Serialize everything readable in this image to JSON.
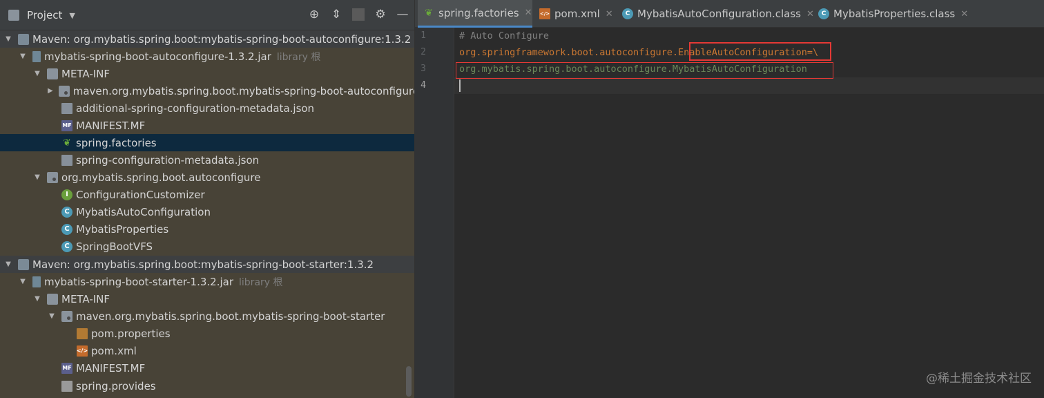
{
  "project_panel": {
    "title": "Project",
    "tree": [
      {
        "label": "Maven: org.mybatis.spring.boot:mybatis-spring-boot-autoconfigure:1.3.2",
        "icon": "maven-library-icon"
      },
      {
        "label": "mybatis-spring-boot-autoconfigure-1.3.2.jar",
        "note": "library 根",
        "icon": "jar-icon"
      },
      {
        "label": "META-INF",
        "icon": "folder-icon"
      },
      {
        "label": "maven.org.mybatis.spring.boot.mybatis-spring-boot-autoconfigure",
        "icon": "package-folder-icon"
      },
      {
        "label": "additional-spring-configuration-metadata.json",
        "icon": "json-spring-icon"
      },
      {
        "label": "MANIFEST.MF",
        "icon": "manifest-icon"
      },
      {
        "label": "spring.factories",
        "icon": "spring-leaf-icon"
      },
      {
        "label": "spring-configuration-metadata.json",
        "icon": "json-file-icon"
      },
      {
        "label": "org.mybatis.spring.boot.autoconfigure",
        "icon": "package-folder-icon"
      },
      {
        "label": "ConfigurationCustomizer",
        "icon": "interface-icon"
      },
      {
        "label": "MybatisAutoConfiguration",
        "icon": "class-icon"
      },
      {
        "label": "MybatisProperties",
        "icon": "class-icon"
      },
      {
        "label": "SpringBootVFS",
        "icon": "class-icon"
      },
      {
        "label": "Maven: org.mybatis.spring.boot:mybatis-spring-boot-starter:1.3.2",
        "icon": "maven-library-icon"
      },
      {
        "label": "mybatis-spring-boot-starter-1.3.2.jar",
        "note": "library 根",
        "icon": "jar-icon"
      },
      {
        "label": "META-INF",
        "icon": "folder-icon"
      },
      {
        "label": "maven.org.mybatis.spring.boot.mybatis-spring-boot-starter",
        "icon": "package-folder-icon"
      },
      {
        "label": "pom.properties",
        "icon": "properties-file-icon"
      },
      {
        "label": "pom.xml",
        "icon": "xml-file-icon"
      },
      {
        "label": "MANIFEST.MF",
        "icon": "manifest-icon"
      },
      {
        "label": "spring.provides",
        "icon": "plain-file-icon"
      }
    ]
  },
  "editor": {
    "tabs": [
      {
        "label": "spring.factories",
        "icon": "spring-leaf-icon",
        "active": true
      },
      {
        "label": "pom.xml",
        "icon": "xml-file-icon"
      },
      {
        "label": "MybatisAutoConfiguration.class",
        "icon": "class-icon"
      },
      {
        "label": "MybatisProperties.class",
        "icon": "class-icon"
      }
    ],
    "line_numbers": [
      "1",
      "2",
      "3",
      "4"
    ],
    "lines": {
      "l1": "# Auto Configure",
      "l2_prefix": "org.springframework.boot.autoconfigure.",
      "l2_highlight": "EnableAutoConfiguration",
      "l2_suffix": "=\\",
      "l3": "org.mybatis.spring.boot.autoconfigure.MybatisAutoConfiguration"
    }
  },
  "colors": {
    "panel_bg": "#484337",
    "selection": "#0d293e",
    "editor_bg": "#2b2b2b",
    "key_orange": "#cc7832",
    "value_green": "#6a8759",
    "comment_gray": "#808080",
    "highlight_box_red": "#e53935"
  },
  "watermark": "@稀土掘金技术社区"
}
